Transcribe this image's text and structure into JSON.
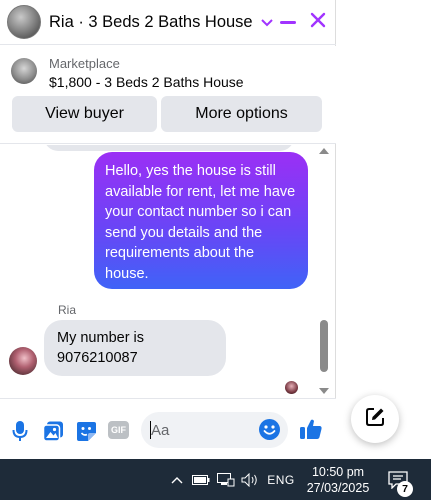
{
  "colors": {
    "accent": "#a133ff",
    "outgoing_gradient_top": "#9b2ff5",
    "outgoing_gradient_bottom": "#3f63f7",
    "messenger_blue": "#1b74e4",
    "incoming_bubble": "#e4e6eb",
    "taskbar": "#1e2b39"
  },
  "header": {
    "title": "Ria · 3 Beds 2 Baths House",
    "chevron_icon": "chevron-down-icon",
    "minimize_icon": "minimize-icon",
    "close_icon": "close-icon"
  },
  "listing": {
    "source": "Marketplace",
    "title": "$1,800 - 3 Beds 2 Baths House",
    "view_buyer_label": "View buyer",
    "more_options_label": "More options"
  },
  "messages": [
    {
      "direction": "outgoing",
      "text": "Hello, yes the house is still available for rent, let me have your contact number so i can send you details and the requirements about the house."
    },
    {
      "direction": "incoming",
      "sender": "Ria",
      "text": "My number is 9076210087"
    }
  ],
  "composer": {
    "placeholder": "Aa",
    "icons": [
      "microphone-icon",
      "photo-icon",
      "sticker-icon",
      "gif-icon",
      "emoji-icon",
      "like-thumb-icon"
    ],
    "gif_label": "GIF"
  },
  "new_message_icon": "compose-icon",
  "taskbar": {
    "language": "ENG",
    "time": "10:50 pm",
    "date": "27/03/2025",
    "notification_count": "7",
    "tray_icons": [
      "show-hidden-icons-chevron",
      "battery-icon",
      "network-icon",
      "volume-icon",
      "notification-center-icon"
    ]
  }
}
